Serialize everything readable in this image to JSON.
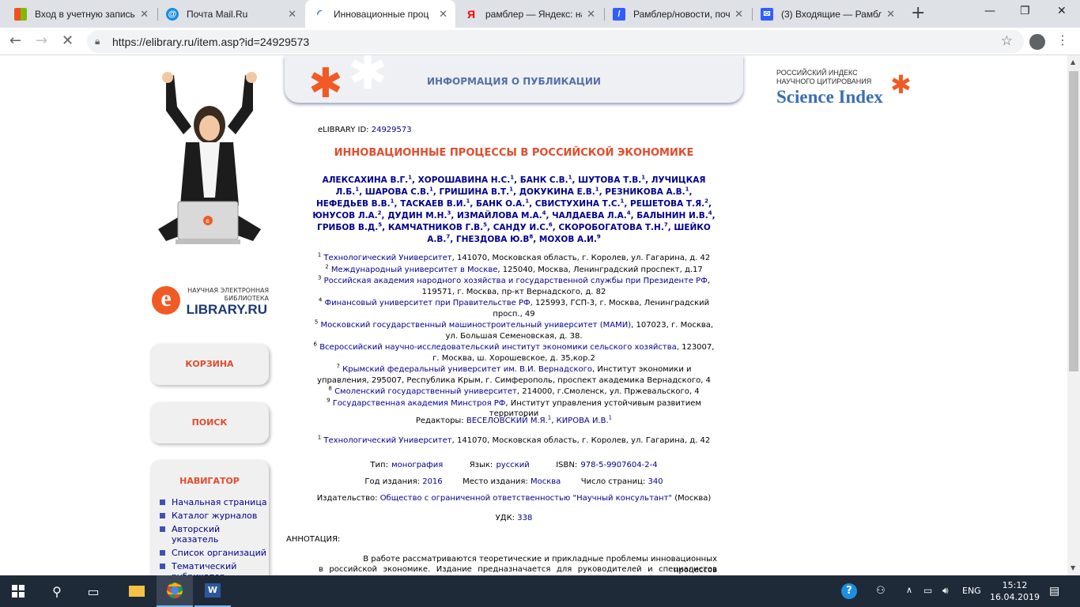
{
  "browser": {
    "tabs": [
      {
        "title": "Вход в учетную запись",
        "icon": "microsoft-icon"
      },
      {
        "title": "Почта Mail.Ru",
        "icon": "mailru-icon"
      },
      {
        "title": "Инновационные проц",
        "icon": "loading-icon",
        "active": true
      },
      {
        "title": "рамблер — Яндекс: на",
        "icon": "yandex-icon"
      },
      {
        "title": "Рамблер/новости, поч",
        "icon": "rambler-icon"
      },
      {
        "title": "(3) Входящие — Рамбл",
        "icon": "mail-icon"
      }
    ],
    "url": "https://elibrary.ru/item.asp?id=24929573"
  },
  "sidebar": {
    "logo_line1": "НАУЧНАЯ ЭЛЕКТРОННАЯ",
    "logo_line2": "БИБЛИОТЕКА",
    "logo_brand": "LIBRARY.RU",
    "logo_letter": "e",
    "cart_label": "КОРЗИНА",
    "search_label": "ПОИСК",
    "nav_title": "НАВИГАТОР",
    "nav_items": [
      "Начальная страница",
      "Каталог журналов",
      "Авторский указатель",
      "Список организаций",
      "Тематический рубрикатор"
    ]
  },
  "header": {
    "banner_title": "ИНФОРМАЦИЯ О ПУБЛИКАЦИИ",
    "si_line1": "РОССИЙСКИЙ ИНДЕКС",
    "si_line2": "НАУЧНОГО ЦИТИРОВАНИЯ",
    "si_brand": "Science Index"
  },
  "publication": {
    "id_label": "eLIBRARY ID:",
    "id_value": "24929573",
    "title": "ИННОВАЦИОННЫЕ ПРОЦЕССЫ В РОССИЙСКОЙ ЭКОНОМИКЕ",
    "authors": [
      {
        "name": "АЛЕКСАХИНА В.Г.",
        "aff": "1"
      },
      {
        "name": "ХОРОШАВИНА Н.С.",
        "aff": "1"
      },
      {
        "name": "БАНК С.В.",
        "aff": "1"
      },
      {
        "name": "ШУТОВА Т.В.",
        "aff": "1"
      },
      {
        "name": "ЛУЧИЦКАЯ Л.Б.",
        "aff": "1"
      },
      {
        "name": "ШАРОВА С.В.",
        "aff": "1"
      },
      {
        "name": "ГРИШИНА В.Т.",
        "aff": "1"
      },
      {
        "name": "ДОКУКИНА Е.В.",
        "aff": "1"
      },
      {
        "name": "РЕЗНИКОВА А.В.",
        "aff": "1"
      },
      {
        "name": "НЕФЕДЬЕВ В.В.",
        "aff": "1"
      },
      {
        "name": "ТАСКАЕВ В.И.",
        "aff": "1"
      },
      {
        "name": "БАНК О.А.",
        "aff": "1"
      },
      {
        "name": "СВИСТУХИНА Т.С.",
        "aff": "1"
      },
      {
        "name": "РЕШЕТОВА Т.Я.",
        "aff": "2"
      },
      {
        "name": "ЮНУСОВ Л.А.",
        "aff": "2"
      },
      {
        "name": "ДУДИН М.Н.",
        "aff": "3"
      },
      {
        "name": "ИЗМАЙЛОВА М.А.",
        "aff": "4"
      },
      {
        "name": "ЧАЛДАЕВА Л.А.",
        "aff": "4"
      },
      {
        "name": "БАЛЫНИН И.В.",
        "aff": "4"
      },
      {
        "name": "ГРИБОВ В.Д.",
        "aff": "5"
      },
      {
        "name": "КАМЧАТНИКОВ Г.В.",
        "aff": "5"
      },
      {
        "name": "САНДУ И.С.",
        "aff": "6"
      },
      {
        "name": "СКОРОБОГАТОВА Т.Н.",
        "aff": "7"
      },
      {
        "name": "ШЕЙКО А.В.",
        "aff": "7"
      },
      {
        "name": "ГНЕЗДОВА Ю.В",
        "aff": "8"
      },
      {
        "name": "МОХОВ А.И.",
        "aff": "9"
      }
    ],
    "affiliations": [
      {
        "n": "1",
        "org": "Технологический Университет",
        "addr": ", 141070, Московская область, г. Королев, ул. Гагарина, д. 42"
      },
      {
        "n": "2",
        "org": "Международный университет в Москве",
        "addr": ", 125040, Москва, Ленинградский проспект, д.17"
      },
      {
        "n": "3",
        "org": "Российская академия народного хозяйства и государственной службы при Президенте РФ",
        "addr": ", 119571, г. Москва, пр-кт Вернадского, д. 82"
      },
      {
        "n": "4",
        "org": "Финансовый университет при Правительстве РФ",
        "addr": ", 125993, ГСП-3, г. Москва, Ленинградский просп., 49"
      },
      {
        "n": "5",
        "org": "Московский государственный машиностроительный университет (МАМИ)",
        "addr": ", 107023, г. Москва, ул. Большая Семеновская, д. 38."
      },
      {
        "n": "6",
        "org": "Всероссийский научно-исследовательский институт экономики сельского хозяйства",
        "addr": ", 123007, г. Москва, ш. Хорошевское, д. 35,кор.2"
      },
      {
        "n": "7",
        "org": "Крымский федеральный университет им. В.И. Вернадского",
        "addr": ", Институт экономики и управления, 295007, Республика Крым, г. Симферополь, проспект академика Вернадского, 4"
      },
      {
        "n": "8",
        "org": "Смоленский государственный университет",
        "addr": ", 214000, г.Смоленск, ул. Пржевальского, 4"
      },
      {
        "n": "9",
        "org": "Государственная академия Минстроя РФ",
        "addr": ", Институт управления устойчивым развитием территории"
      }
    ],
    "editors_label": "Редакторы:",
    "editors": [
      {
        "name": "ВЕСЕЛОВСКИЙ М.Я.",
        "aff": "1"
      },
      {
        "name": "КИРОВА И.В.",
        "aff": "1"
      }
    ],
    "editor_aff": {
      "n": "1",
      "org": "Технологический Университет",
      "addr": ", 141070, Московская область, г. Королев, ул. Гагарина, д. 42"
    },
    "type_label": "Тип:",
    "type_value": "монография",
    "lang_label": "Язык:",
    "lang_value": "русский",
    "isbn_label": "ISBN:",
    "isbn_value": "978-5-9907604-2-4",
    "year_label": "Год издания:",
    "year_value": "2016",
    "place_label": "Место издания:",
    "place_value": "Москва",
    "pages_label": "Число страниц:",
    "pages_value": "340",
    "publisher_label": "Издательство:",
    "publisher_value": "Общество с ограниченной ответственностью \"Научный консультант\"",
    "publisher_city": "(Москва)",
    "udk_label": "УДК:",
    "udk_value": "338",
    "annotation_label": "АННОТАЦИЯ:",
    "annotation_line1": "В работе рассматриваются теоретические и прикладные проблемы инновационных процессов",
    "annotation_line2": "в российской экономике. Издание предназначается для руководителей и специалистов"
  },
  "taskbar": {
    "time": "15:12",
    "date": "16.04.2019",
    "lang": "ENG"
  }
}
